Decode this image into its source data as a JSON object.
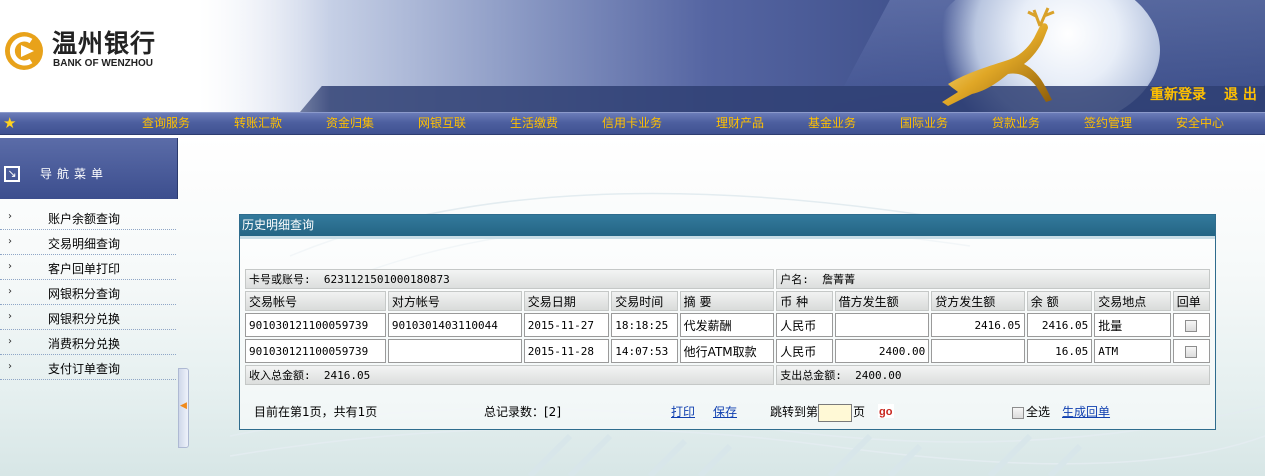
{
  "bank": {
    "name_cn": "温州银行",
    "name_en": "BANK OF WENZHOU"
  },
  "top_links": {
    "relogin": "重新登录",
    "logout": "退 出"
  },
  "nav": {
    "items": [
      "查询服务",
      "转账汇款",
      "资金归集",
      "网银互联",
      "生活缴费",
      "信用卡业务",
      "理财产品",
      "基金业务",
      "国际业务",
      "贷款业务",
      "签约管理",
      "安全中心"
    ]
  },
  "sidebar": {
    "title": "导航菜单",
    "items": [
      "账户余额查询",
      "交易明细查询",
      "客户回单打印",
      "网银积分查询",
      "网银积分兑换",
      "消费积分兑换",
      "支付订单查询"
    ]
  },
  "panel": {
    "title": "历史明细查询",
    "account_label": "卡号或账号:",
    "account_no": "6231121501000180873",
    "owner_label": "户名:",
    "owner_name": "詹菁菁",
    "columns": [
      "交易帐号",
      "对方帐号",
      "交易日期",
      "交易时间",
      "摘 要",
      "币 种",
      "借方发生额",
      "贷方发生额",
      "余 额",
      "交易地点",
      "回单"
    ],
    "rows": [
      {
        "account": "901030121100059739",
        "counterparty": "9010301403110044",
        "date": "2015-11-27",
        "time": "18:18:25",
        "summary": "代发薪酬",
        "currency": "人民币",
        "debit": "",
        "credit": "2416.05",
        "balance": "2416.05",
        "location": "批量",
        "receipt": false
      },
      {
        "account": "901030121100059739",
        "counterparty": "",
        "date": "2015-11-28",
        "time": "14:07:53",
        "summary": "他行ATM取款",
        "currency": "人民币",
        "debit": "2400.00",
        "credit": "",
        "balance": "16.05",
        "location": "ATM",
        "receipt": false
      }
    ],
    "income_label": "收入总金额:",
    "income_total": "2416.05",
    "expense_label": "支出总金额:",
    "expense_total": "2400.00"
  },
  "footer": {
    "page_info": "目前在第1页，共有1页",
    "record_count": "总记录数：[2]",
    "print": "打印",
    "save": "保存",
    "jump_prefix": "跳转到第",
    "jump_suffix": "页",
    "go": "go",
    "select_all": "全选",
    "generate_receipt": "生成回单"
  },
  "colors": {
    "header_dark": "#34477e",
    "nav_text": "#ffc000",
    "panel_title": "#2a6e8f",
    "link": "#0f3fb0"
  }
}
